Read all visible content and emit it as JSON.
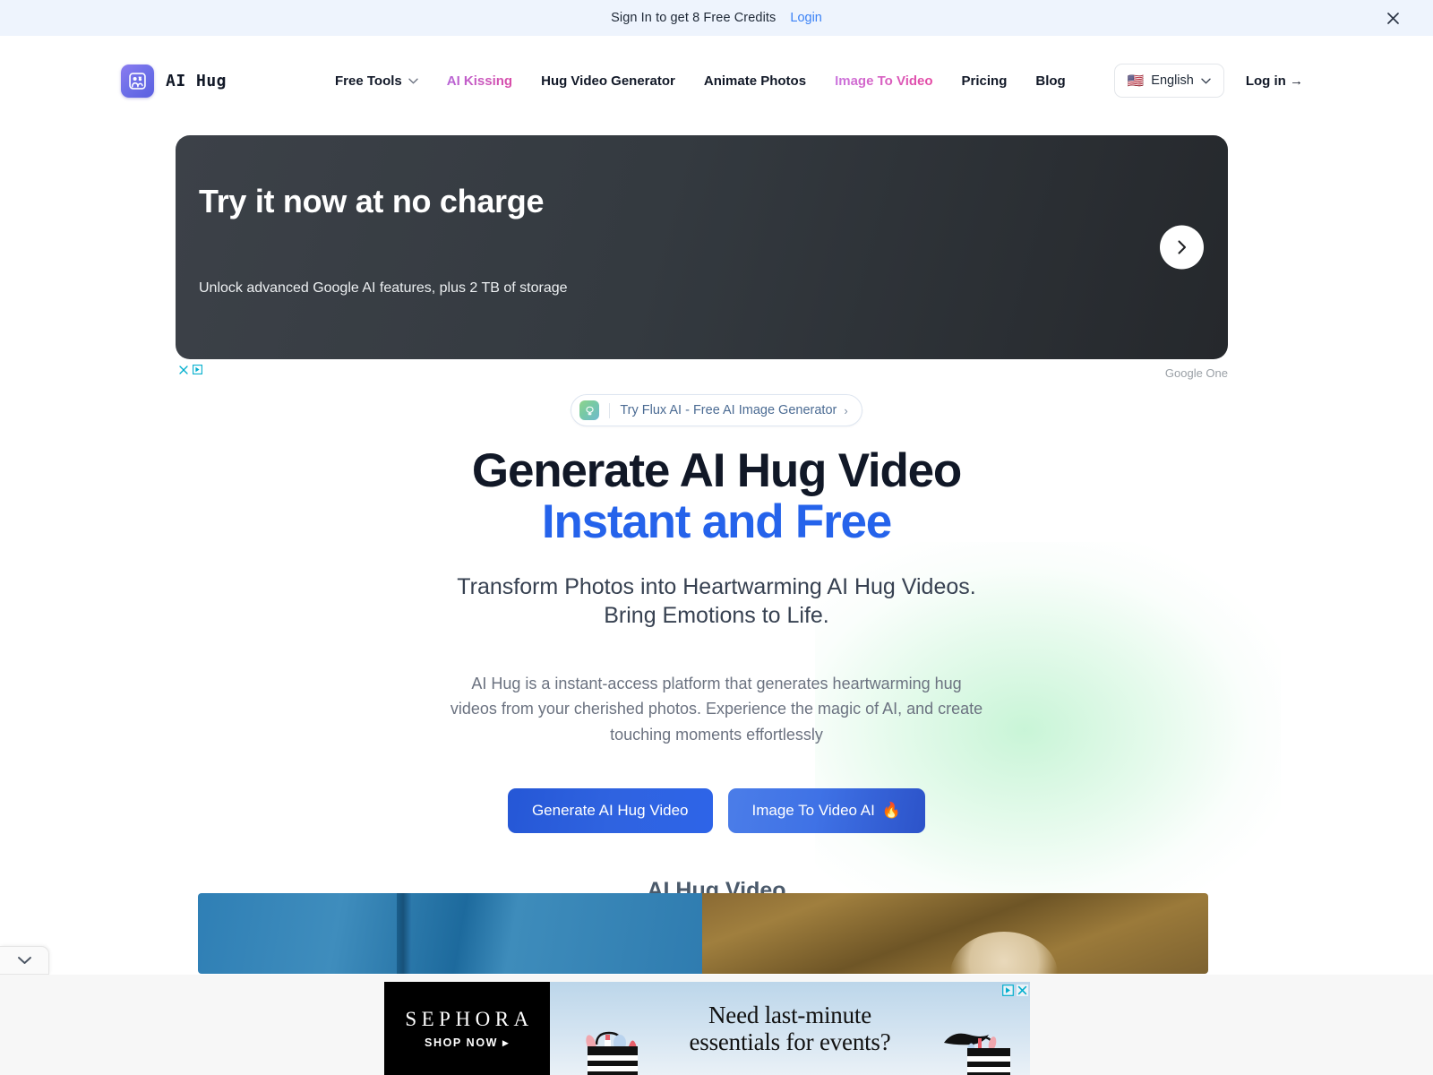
{
  "topbar": {
    "message": "Sign In to get 8 Free Credits",
    "login_label": "Login",
    "close_icon": "close-icon"
  },
  "nav": {
    "brand": {
      "name": "AI  Hug",
      "logo_icon": "hug-logo-icon"
    },
    "links": [
      {
        "label": "Free Tools",
        "style": "default",
        "has_chevron": true
      },
      {
        "label": "AI Kissing",
        "style": "pink",
        "has_chevron": false
      },
      {
        "label": "Hug Video Generator",
        "style": "default",
        "has_chevron": false
      },
      {
        "label": "Animate Photos",
        "style": "default",
        "has_chevron": false
      },
      {
        "label": "Image To Video",
        "style": "gradient",
        "has_chevron": false
      },
      {
        "label": "Pricing",
        "style": "default",
        "has_chevron": false
      },
      {
        "label": "Blog",
        "style": "default",
        "has_chevron": false
      }
    ],
    "language": {
      "flag": "🇺🇸",
      "label": "English",
      "chevron_icon": "chevron-down-icon"
    },
    "login": "Log in →"
  },
  "ad_banner": {
    "title": "Try it now at no charge",
    "subtitle": "Unlock advanced Google AI features, plus 2 TB of storage",
    "next_icon": "chevron-right-icon",
    "adchoices_icon": "adchoices-icon",
    "provider": "Google One"
  },
  "hero": {
    "badge": {
      "icon": "flux-tree-icon",
      "text": "Try Flux AI - Free AI Image Generator",
      "chevron": "›"
    },
    "title_line1": "Generate AI Hug Video",
    "title_line2": "Instant and Free",
    "subtitle_line1": "Transform Photos into Heartwarming AI Hug Videos.",
    "subtitle_line2": "Bring Emotions to Life.",
    "description": "AI Hug is a instant-access platform that generates heartwarming hug videos from your cherished photos. Experience the magic of AI, and create touching moments effortlessly",
    "primary_cta": "Generate AI Hug Video",
    "secondary_cta": "Image To Video AI",
    "secondary_cta_emoji": "🔥",
    "section_title": "AI Hug Video",
    "accent_blue": "#2563eb",
    "glow_color": "#7ee6a0"
  },
  "bottom_ad": {
    "brand": "SEPHORA",
    "cta": "SHOP NOW ▸",
    "headline_line1": "Need last-minute",
    "headline_line2": "essentials for events?",
    "adchoices_icon": "adchoices-icon",
    "close_icon": "close-icon"
  },
  "collapse_tab": {
    "icon": "chevron-down-icon"
  }
}
